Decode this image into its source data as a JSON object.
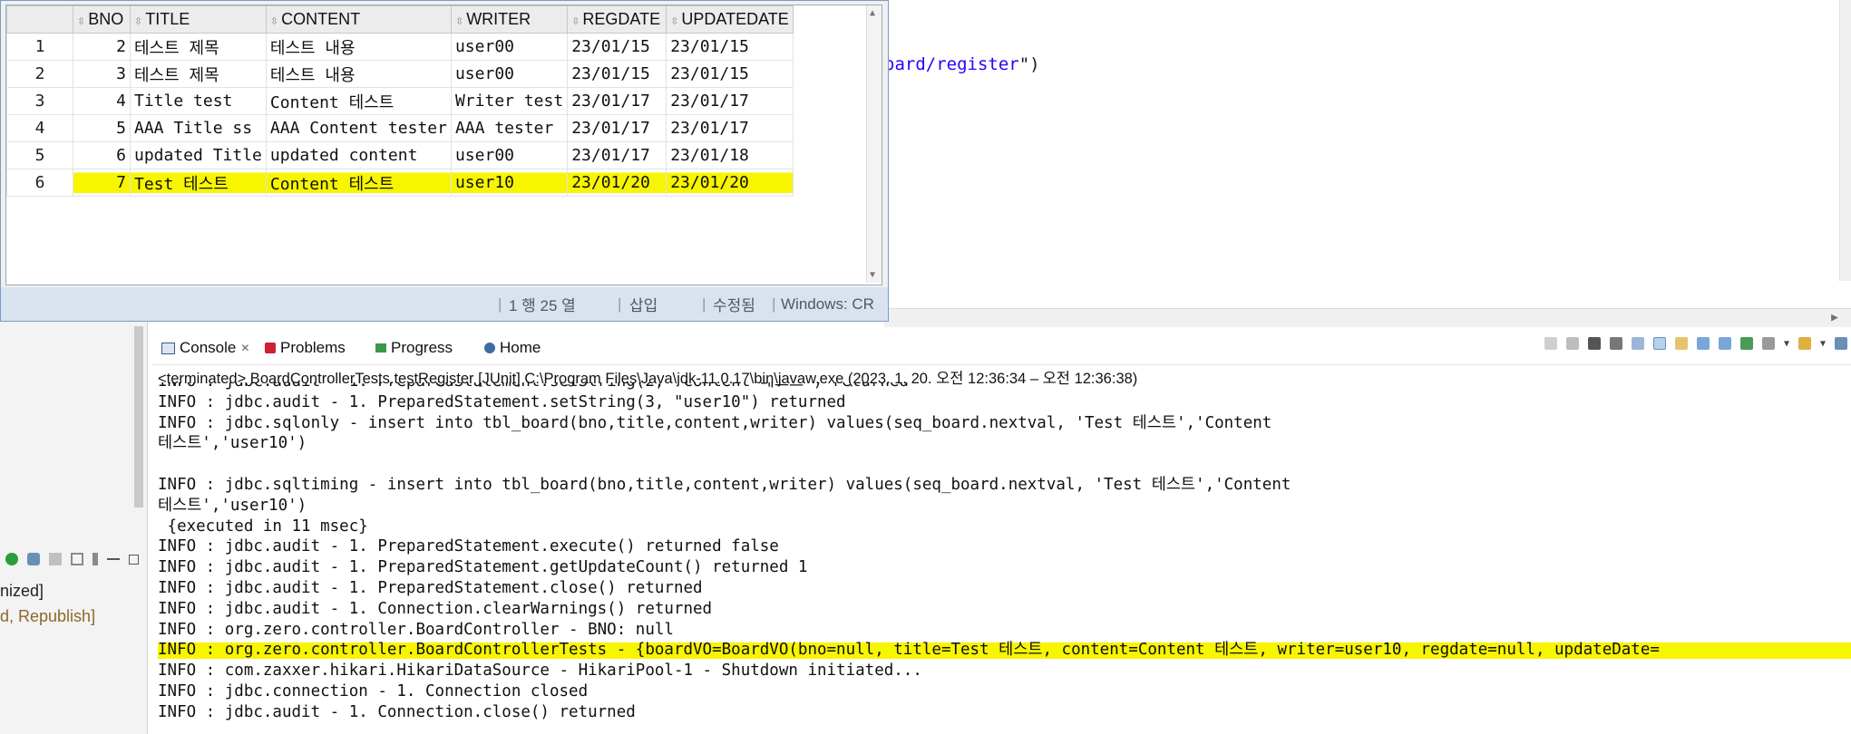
{
  "editor": {
    "code_prefix": "oard/register",
    "code_suffix": "\")"
  },
  "data_grid": {
    "columns": [
      "",
      "BNO",
      "TITLE",
      "CONTENT",
      "WRITER",
      "REGDATE",
      "UPDATEDATE"
    ],
    "rows": [
      {
        "rownum": "1",
        "bno": "2",
        "title": "테스트 제목",
        "content": "테스트 내용",
        "writer": "user00",
        "regdate": "23/01/15",
        "updatedate": "23/01/15"
      },
      {
        "rownum": "2",
        "bno": "3",
        "title": "테스트 제목",
        "content": "테스트 내용",
        "writer": "user00",
        "regdate": "23/01/15",
        "updatedate": "23/01/15"
      },
      {
        "rownum": "3",
        "bno": "4",
        "title": "Title test",
        "content": "Content 테스트",
        "writer": "Writer test",
        "regdate": "23/01/17",
        "updatedate": "23/01/17"
      },
      {
        "rownum": "4",
        "bno": "5",
        "title": "AAA Title ss",
        "content": "AAA Content tester",
        "writer": "AAA tester",
        "regdate": "23/01/17",
        "updatedate": "23/01/17"
      },
      {
        "rownum": "5",
        "bno": "6",
        "title": "updated Title",
        "content": "updated content",
        "writer": "user00",
        "regdate": "23/01/17",
        "updatedate": "23/01/18"
      },
      {
        "rownum": "6",
        "bno": "7",
        "title": "Test 테스트",
        "content": "Content 테스트",
        "writer": "user10",
        "regdate": "23/01/20",
        "updatedate": "23/01/20"
      }
    ],
    "highlighted_row": 5
  },
  "statusbar": {
    "position": "1 행 25 열",
    "mode": "삽입",
    "modified": "수정됨",
    "encoding": "Windows: CR"
  },
  "left_panel": {
    "text1": "nized]",
    "text2": "d, Republish]"
  },
  "console_view": {
    "tabs": [
      {
        "label": "Console",
        "icon": "console-icon"
      },
      {
        "label": "Problems",
        "icon": "problems-icon"
      },
      {
        "label": "Progress",
        "icon": "progress-icon"
      },
      {
        "label": "Home",
        "icon": "home-icon"
      }
    ],
    "header": "<terminated> BoardControllerTests.testRegister [JUnit] C:\\Program Files\\Java\\jdk-11.0.17\\bin\\javaw.exe  (2023. 1. 20. 오전 12:36:34 – 오전 12:36:38)",
    "lines": [
      "INFO : jdbc.audit - 1. PreparedStatement.setString(2, \"Content 테스트\") returned",
      "INFO : jdbc.audit - 1. PreparedStatement.setString(3, \"user10\") returned",
      "INFO : jdbc.sqlonly - insert into tbl_board(bno,title,content,writer) values(seq_board.nextval, 'Test 테스트','Content",
      "테스트','user10')",
      "",
      "INFO : jdbc.sqltiming - insert into tbl_board(bno,title,content,writer) values(seq_board.nextval, 'Test 테스트','Content",
      "테스트','user10')",
      " {executed in 11 msec}",
      "INFO : jdbc.audit - 1. PreparedStatement.execute() returned false",
      "INFO : jdbc.audit - 1. PreparedStatement.getUpdateCount() returned 1",
      "INFO : jdbc.audit - 1. PreparedStatement.close() returned",
      "INFO : jdbc.audit - 1. Connection.clearWarnings() returned",
      "INFO : org.zero.controller.BoardController - BNO: null",
      "INFO : org.zero.controller.BoardControllerTests - {boardVO=BoardVO(bno=null, title=Test 테스트, content=Content 테스트, writer=user10, regdate=null, updateDate=",
      "INFO : com.zaxxer.hikari.HikariDataSource - HikariPool-1 - Shutdown initiated...",
      "INFO : jdbc.connection - 1. Connection closed",
      "INFO : jdbc.audit - 1. Connection.close() returned"
    ],
    "highlighted_line": 13
  },
  "colors": {
    "highlight": "#f7f500",
    "statusbar_bg": "#d8e3ef"
  }
}
